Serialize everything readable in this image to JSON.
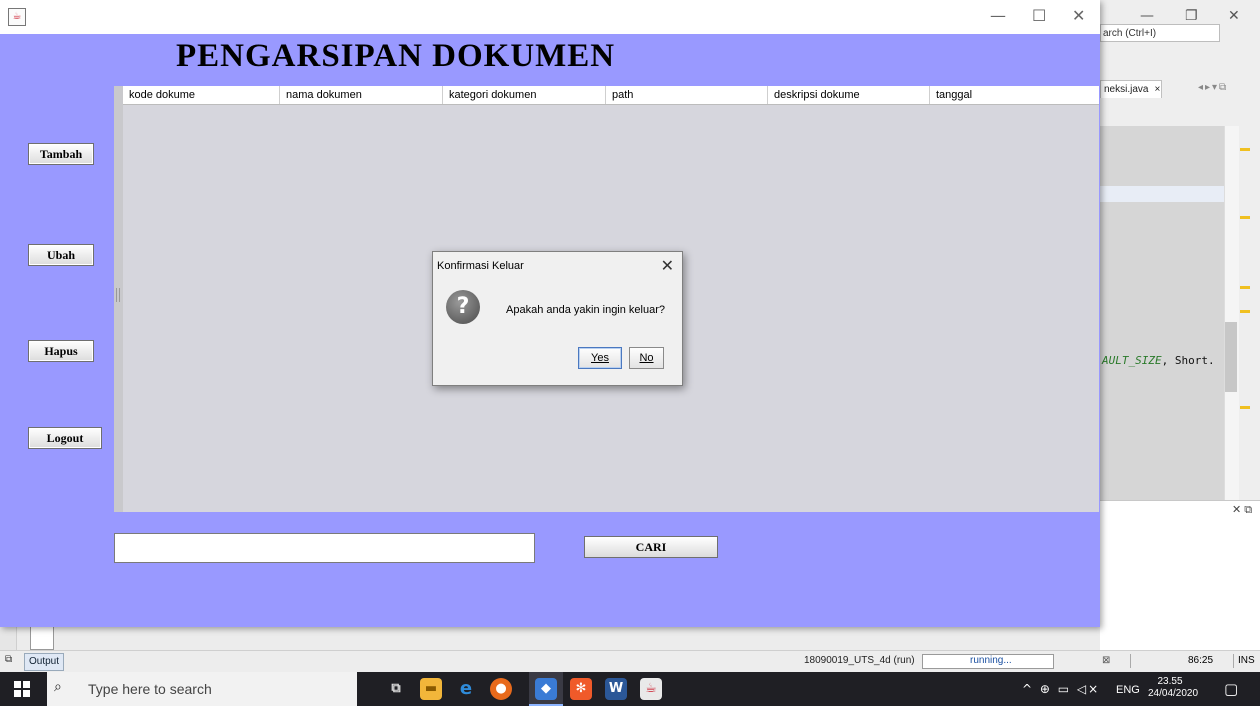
{
  "ide": {
    "search_placeholder": "arch (Ctrl+I)",
    "editor_tab": "neksi.java",
    "editor_tab_close": "×",
    "code_fragment_const": "AULT_SIZE",
    "code_fragment_rest": ", Short.",
    "output_tab": "Output",
    "run_label": "18090019_UTS_4d (run)",
    "run_status": "running...",
    "cursor_pos": "86:25",
    "insert_mode": "INS"
  },
  "app": {
    "window_icon": "java-icon",
    "heading": "PENGARSIPAN DOKUMEN",
    "side_buttons": {
      "add": "Tambah",
      "edit": "Ubah",
      "delete": "Hapus",
      "logout": "Logout"
    },
    "table": {
      "columns": [
        "kode dokume",
        "nama dokumen",
        "kategori dokumen",
        "path",
        "deskripsi dokume",
        "tanggal"
      ]
    },
    "search": {
      "value": "",
      "button": "CARI"
    }
  },
  "dialog": {
    "title": "Konfirmasi Keluar",
    "message": "Apakah anda yakin ingin keluar?",
    "yes": "Yes",
    "no": "No",
    "icon": "question-icon"
  },
  "taskbar": {
    "search_placeholder": "Type here to search",
    "language": "ENG",
    "time": "23.55",
    "date": "24/04/2020"
  },
  "colors": {
    "app_background": "#9999ff",
    "table_background": "#d6d6dd",
    "taskbar": "#1f1f24"
  }
}
